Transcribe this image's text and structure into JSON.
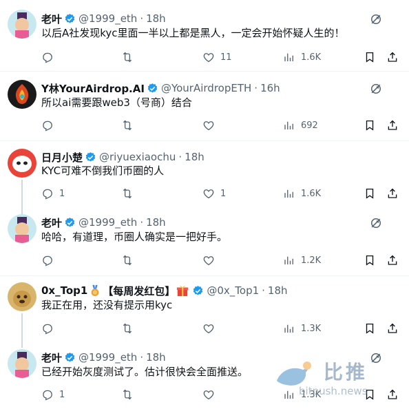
{
  "colors": {
    "verified": "#1d9bf0",
    "muted": "#536471",
    "thread_line": "#cfd9de"
  },
  "tweets": [
    {
      "name": "老叶",
      "handle": "@1999_eth",
      "time": "18h",
      "text": "以后A社发现kyc里面一半以上都是黑人，一定会开始怀疑人生的！",
      "reply_count": "",
      "retweet_count": "",
      "like_count": "11",
      "view_count": "1.6K"
    },
    {
      "name": "Y林YourAirdrop.AI",
      "handle": "@YourAirdropETH",
      "time": "16h",
      "text": "所以ai需要跟web3（号商）结合",
      "reply_count": "",
      "retweet_count": "",
      "like_count": "",
      "view_count": "692"
    },
    {
      "name": "日月小楚",
      "handle": "@riyuexiaochu",
      "time": "18h",
      "text": "KYC可难不倒我们币圈的人",
      "reply_count": "1",
      "retweet_count": "",
      "like_count": "1",
      "view_count": "1.6K"
    },
    {
      "name": "老叶",
      "handle": "@1999_eth",
      "time": "18h",
      "text": "哈哈，有道理，币圈人确实是一把好手。",
      "reply_count": "",
      "retweet_count": "",
      "like_count": "",
      "view_count": "1.2K"
    },
    {
      "name_prefix": "0x_Top1",
      "name_suffix": "【每周发红包】",
      "handle": "@0x_Top1",
      "time": "18h",
      "text": "我正在用，还没有提示用kyc",
      "reply_count": "",
      "retweet_count": "",
      "like_count": "",
      "view_count": "1.3K"
    },
    {
      "name": "老叶",
      "handle": "@1999_eth",
      "time": "18h",
      "text": "已经开始灰度测试了。估计很快会全面推送。",
      "reply_count": "1",
      "retweet_count": "",
      "like_count": "",
      "view_count": "1.3K"
    }
  ],
  "watermark": {
    "cn": "比推",
    "en": "bitpush.news"
  }
}
